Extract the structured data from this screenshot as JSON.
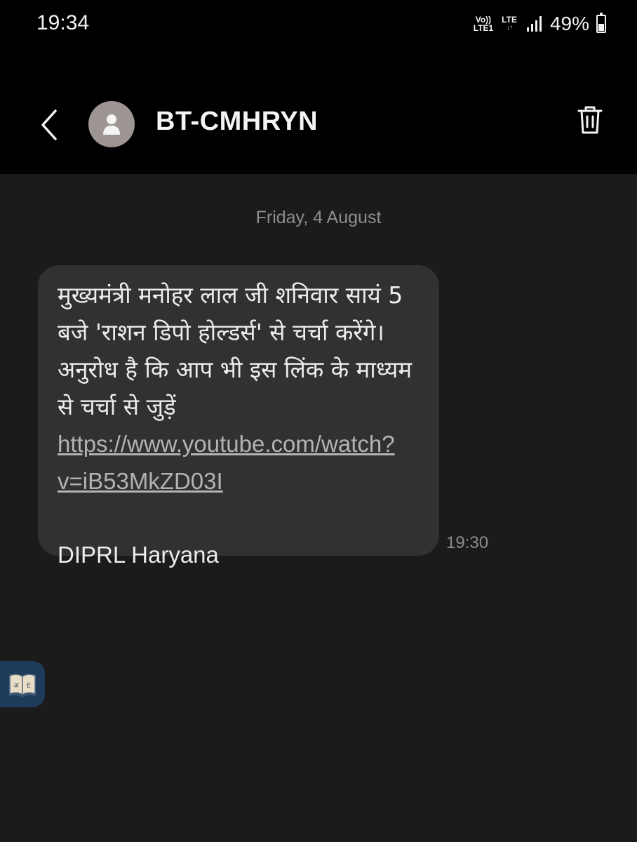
{
  "status_bar": {
    "time": "19:34",
    "network_top": "Vo))",
    "network_bottom": "LTE1",
    "lte_label": "LTE",
    "lte_arrows": "↓↑",
    "battery_percent": "49%"
  },
  "header": {
    "contact_name": "BT-CMHRYN",
    "icons": {
      "back": "chevron-left-icon",
      "avatar": "person-icon",
      "delete": "trash-icon"
    }
  },
  "conversation": {
    "date_separator": "Friday, 4 August",
    "messages": [
      {
        "text": "मुख्यमंत्री मनोहर लाल जी शनिवार सायं 5 बजे 'राशन डिपो होल्डर्स' से चर्चा करेंगे। अनुरोध है कि आप भी इस लिंक के माध्यम से चर्चा से जुड़ें ",
        "link": "https://www.youtube.com/watch?v=iB53MkZD03I",
        "signature": "DIPRL Haryana",
        "time": "19:30"
      }
    ]
  },
  "floating_button": {
    "icon": "dictionary-book-icon",
    "letters": [
      "अ",
      "E"
    ]
  },
  "colors": {
    "app_bar_bg": "#000000",
    "conversation_bg": "#1b1b1b",
    "bubble_bg": "#333030",
    "avatar_bg": "#9c9592",
    "link": "#b3b3b3",
    "muted_text": "#8d8d8d",
    "floating_button_bg": "#1e3c5a"
  }
}
